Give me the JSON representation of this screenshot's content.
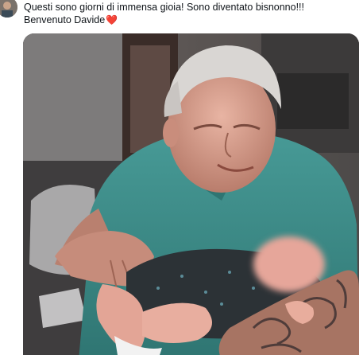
{
  "post": {
    "text_line_1": "Questi sono giorni di immensa gioia! Sono diventato bisnonno!!!",
    "text_line_2": "Benvenuto Davide",
    "heart_emoji": "❤️"
  },
  "colors": {
    "text": "#0f1419",
    "heart": "#e0245e",
    "shirt": "#3f8e8a"
  },
  "icons": {
    "avatar": "profile-avatar",
    "heart": "red-heart-emoji"
  }
}
